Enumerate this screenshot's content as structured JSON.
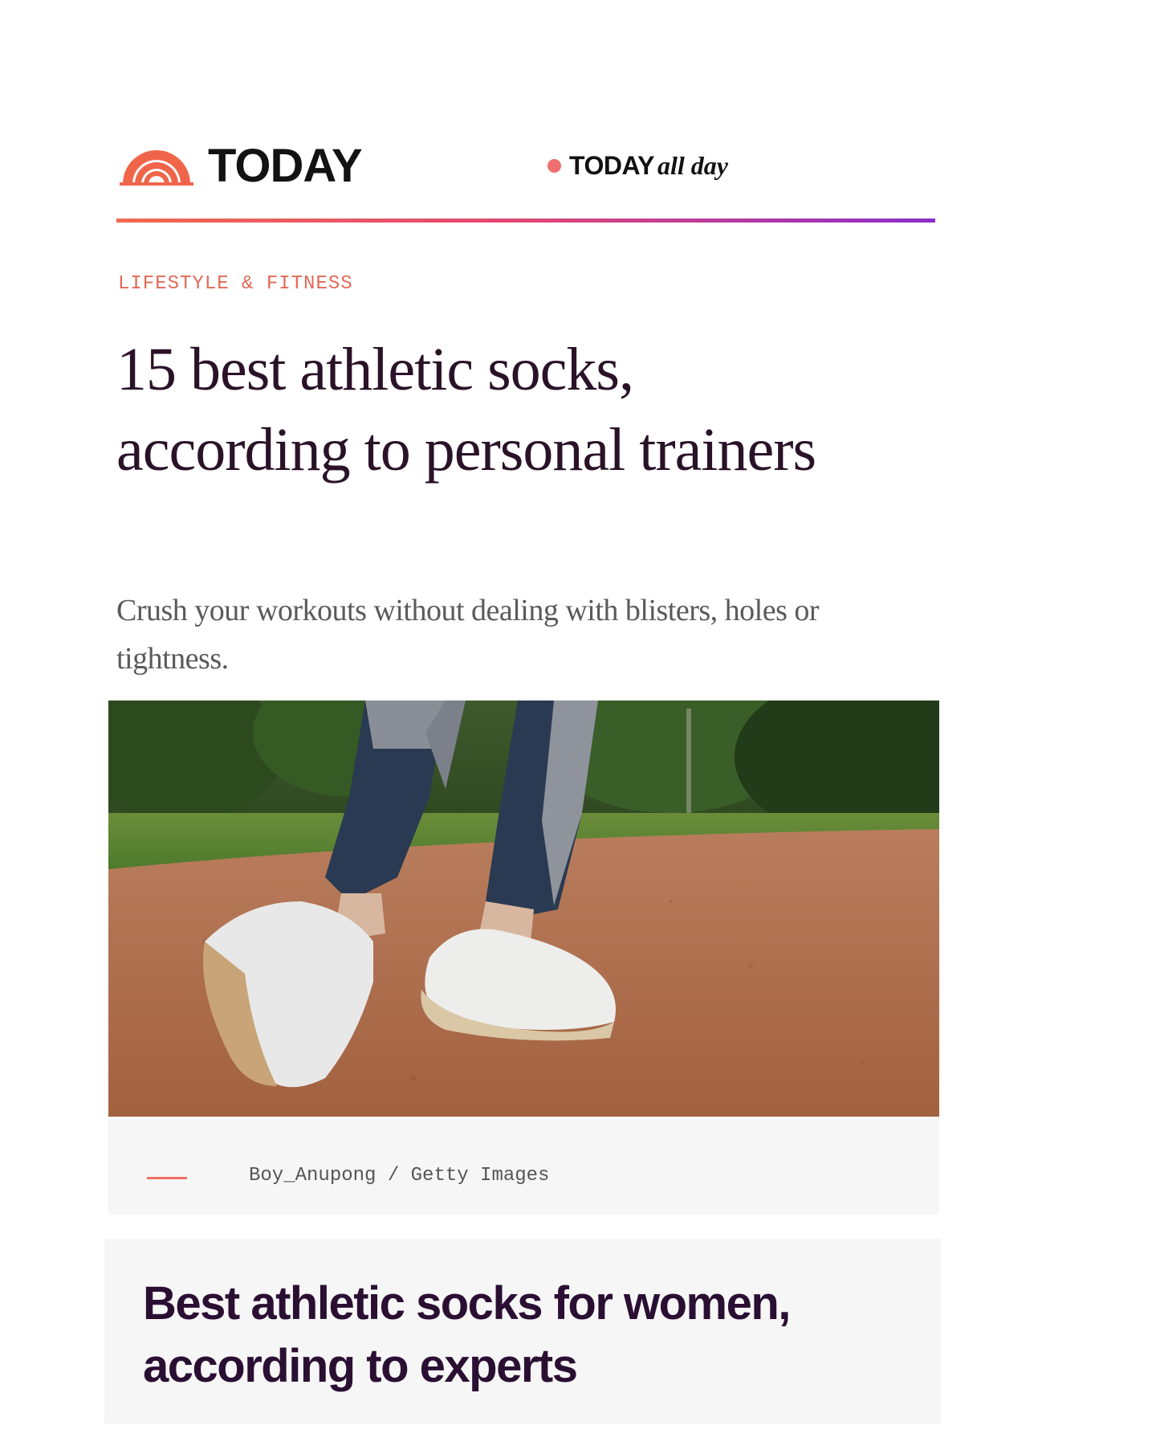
{
  "header": {
    "logo_text": "TODAY",
    "allday_brand": "TODAY",
    "allday_sub": "all day"
  },
  "colors": {
    "brand_coral": "#f26a4f",
    "brand_purple": "#8b2ec9",
    "headline": "#2a1228",
    "section_heading": "#2b0f33",
    "eyebrow": "#e06a57"
  },
  "article": {
    "eyebrow": "LIFESTYLE & FITNESS",
    "headline": "15 best athletic socks, according to personal trainers",
    "dek": "Crush your workouts without dealing with blisters, holes or tightness.",
    "image_credit": "Boy_Anupong / Getty Images"
  },
  "section": {
    "heading": "Best athletic socks for women, according to experts"
  }
}
